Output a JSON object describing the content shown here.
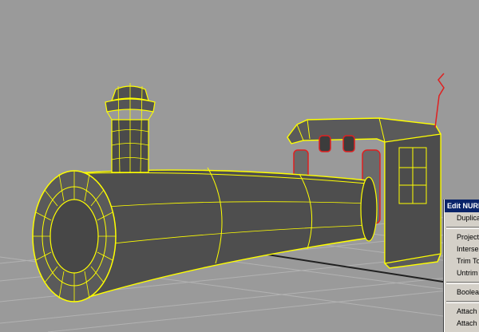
{
  "viewport": {
    "background": "#9a9a9a",
    "grid_color": "#b4b4b4",
    "wire_color": "#ffff00",
    "selection_color": "#e02020",
    "object": "steam-locomotive-nurbs-model"
  },
  "context_menu": {
    "title": "Edit NURB",
    "groups": [
      [
        "Duplica"
      ],
      [
        "Project",
        "Interse",
        "Trim To",
        "Untrim S"
      ],
      [
        "Boolear"
      ],
      [
        "Attach",
        "Attach"
      ]
    ]
  }
}
